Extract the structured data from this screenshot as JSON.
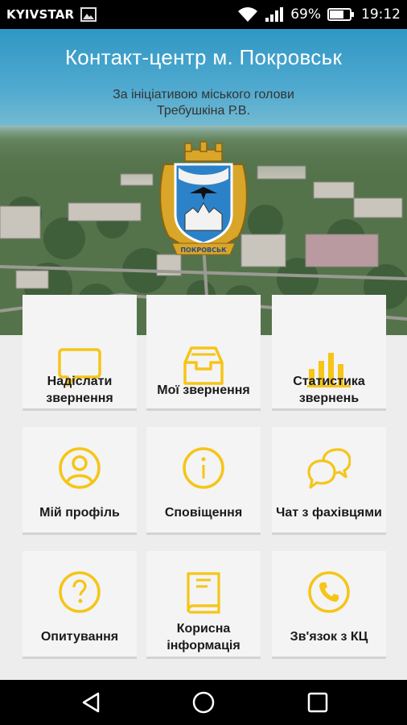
{
  "status_bar": {
    "carrier": "KYIVSTAR",
    "battery": "69%",
    "time": "19:12"
  },
  "header": {
    "title": "Контакт-центр м. Покровськ",
    "subtitle_line1": "За ініціативою міського голови",
    "subtitle_line2": "Требушкіна Р.В."
  },
  "crest": {
    "ribbon_text": "ПОКРОВСЬК"
  },
  "accent_color": "#f5c518",
  "menu": [
    {
      "label_line1": "Надіслати",
      "label_line2": "звернення",
      "icon": "chat-bubble-icon"
    },
    {
      "label_line1": "Мої звернення",
      "label_line2": "",
      "icon": "inbox-icon"
    },
    {
      "label_line1": "Статистика",
      "label_line2": "звернень",
      "icon": "bar-chart-icon"
    },
    {
      "label_line1": "Мій профіль",
      "label_line2": "",
      "icon": "user-profile-icon"
    },
    {
      "label_line1": "Сповіщення",
      "label_line2": "",
      "icon": "info-icon"
    },
    {
      "label_line1": "Чат з фахівцями",
      "label_line2": "",
      "icon": "chat-bubbles-icon"
    },
    {
      "label_line1": "Опитування",
      "label_line2": "",
      "icon": "question-icon"
    },
    {
      "label_line1": "Корисна",
      "label_line2": "інформація",
      "icon": "book-icon"
    },
    {
      "label_line1": "Зв'язок з КЦ",
      "label_line2": "",
      "icon": "phone-icon"
    }
  ]
}
